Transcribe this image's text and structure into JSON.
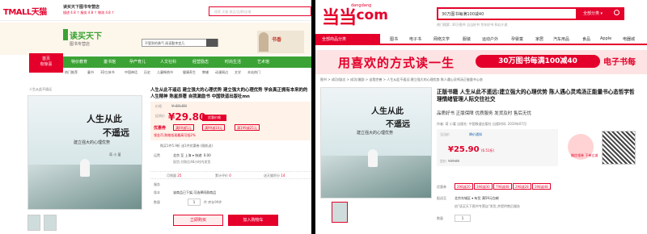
{
  "tmall": {
    "logo": "TMALL天猫",
    "store_name": "读买天下图书专营店",
    "rating": "描述 4.8 ↑ 服务 4.8 ↑ 物流 4.8 ↑",
    "search_placeholder": "搜索 天猫 商品/品牌/店铺",
    "brand_title": "读买天下",
    "brand_sub": "图书专营店",
    "brand_search": "不管到的勇气  阅读勤李宜几",
    "ad_text": "书香",
    "home_label_1": "首页",
    "home_label_2": "有惊喜",
    "nav": [
      "特价教育",
      "童书馆",
      "孕产育儿",
      "人文社科",
      "经营励志",
      "时尚生活",
      "艺术馆"
    ],
    "subnav": [
      "热门推荐",
      "童书",
      "3D立体书",
      "中国神话",
      "历史",
      "儿童畅销书",
      "健康养生",
      "教辅",
      "动漫周边",
      "文学",
      "本站热门"
    ],
    "breadcrumb": "人生从此不遥远",
    "book_title_1": "人生从此",
    "book_title_2": "不遥远",
    "book_sub": "建立强大的心理优势",
    "book_author": "蒋 小 著",
    "title": "人生从此不遥远 建立强大的心理优势 建立强大的心理优势 学会真正拥有本来的的人生精神 陈星辰著 自我激励书 中国铁道出版社mn",
    "price_label": "价格",
    "old_price": "¥ 39.80",
    "promo_label": "促销价",
    "price": "¥29.80",
    "price_tag": "优惠价格",
    "coupon_label": "优惠券",
    "coupons": [
      "满69减5元",
      "满99减10元",
      "满199减25元"
    ],
    "coupon_note": "领金币,购物抵现最高可抵2%",
    "coupon_extra": "购买1件5.9折 送1件优惠卷 (随机送)",
    "ship_label": "运费",
    "ship_value": "北京  至 上海 ▾  快递: 0.00",
    "ship_note": "现货,付款后48小时内发货",
    "service_label": "服务",
    "stats": [
      {
        "label": "月销量",
        "value": "25"
      },
      {
        "label": "累计评价",
        "value": "0"
      },
      {
        "label": "送天猫积分",
        "value": "14"
      }
    ],
    "edition_label": "版本",
    "edition_value": "该商品已下架,可选择同款商品",
    "qty_label": "数量",
    "qty": "1",
    "stock": "件 库存99件",
    "buy_label": "立即购买",
    "cart_label": "加入购物车"
  },
  "dangdang": {
    "logo_main": "当当",
    "logo_sub": "dangdang",
    "logo_com": ".com",
    "search_value": "30万图书每满100减40",
    "search_cat": "全部分类 ▾",
    "hot": "热门搜索:  30万图书  当当好书  京东好书  科幻小说",
    "nav_all": "全部商品分类",
    "nav": [
      "图书",
      "电子书",
      "网络文学",
      "服装",
      "运动户外",
      "孕婴童",
      "家居",
      "汽车用品",
      "食品",
      "Apple",
      "电器城"
    ],
    "banner_text": "用喜欢的方式读一生",
    "banner_promo": "30万图书每满100减40",
    "banner_right": "电子书每",
    "breadcrumb": "图书 > 成功/励志 > 成功/激励 > 自我完善 > 人生从此不遥远:建立强大的心理优势 陈人遇心灵鸡汤正能量书心态",
    "book_title_1": "人生从此",
    "book_title_2": "不遥远",
    "book_sub": "建立强大的心理优势",
    "title": "正版书籍  人生从此不遥远:建立强大的心理优势 陈人遇心灵鸡汤正能量书心态哲学哲理情绪管理人际交往社交",
    "subtitle": "品质好书  正版保障  优质服务  发货及时  售后无忧",
    "meta": "作者: 蒋 小著    出版社: 中国铁道出版社    出版时间: 2019年07月",
    "price_label": "当当价",
    "price": "¥25.90",
    "discount": "(6.51折)",
    "old_label": "定价",
    "old_price": "¥39.80",
    "promo_label": "降价通知",
    "promo_code": "微信领券\n下单立减",
    "coupon_label": "优惠券",
    "coupons": [
      "298减20",
      "398减30",
      "798减48",
      "298减28",
      "398减48"
    ],
    "ship_label": "配送至",
    "ship_value": "北京东城区 ▾  有货  满59元包邮",
    "seller": "由\"读买天下图书专营店\"发货,并提供售后服务",
    "qty_label": "数量",
    "qty": "1"
  }
}
